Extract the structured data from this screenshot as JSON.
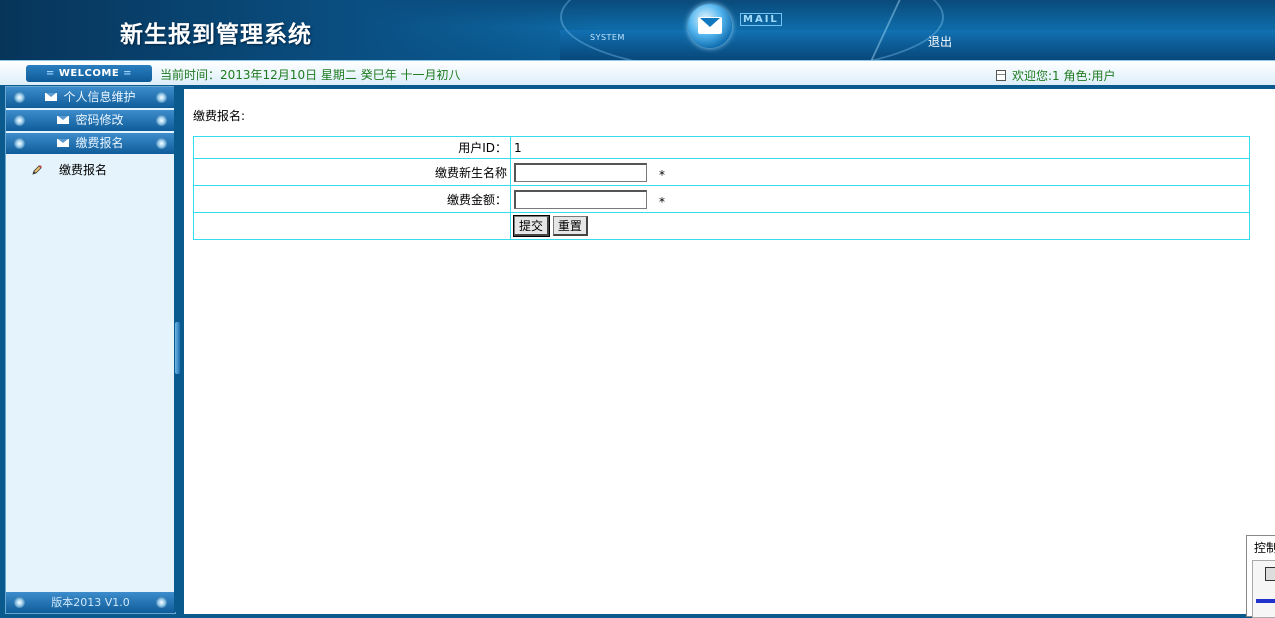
{
  "header": {
    "title": "新生报到管理系统",
    "system_label": "SYSTEM",
    "mail_label": "MAIL",
    "logout": "退出"
  },
  "welcome_bar": {
    "welcome": "WELCOME",
    "current_time": "当前时间：2013年12月10日 星期二 癸巳年 十一月初八",
    "user_info": "欢迎您:1 角色:用户"
  },
  "sidebar": {
    "menus": [
      {
        "label": "个人信息维护"
      },
      {
        "label": "密码修改"
      },
      {
        "label": "缴费报名"
      }
    ],
    "sub_items": [
      {
        "label": "缴费报名"
      }
    ],
    "version": "版本2013 V1.0"
  },
  "main": {
    "heading": "缴费报名:",
    "rows": [
      {
        "label": "用户ID：",
        "value": "1"
      },
      {
        "label": "缴费新生名称",
        "value": "",
        "required": "*"
      },
      {
        "label": "缴费金额：",
        "value": "",
        "required": "*"
      }
    ],
    "submit_label": "提交",
    "reset_label": "重置"
  },
  "control_panel": {
    "label": "控制"
  }
}
